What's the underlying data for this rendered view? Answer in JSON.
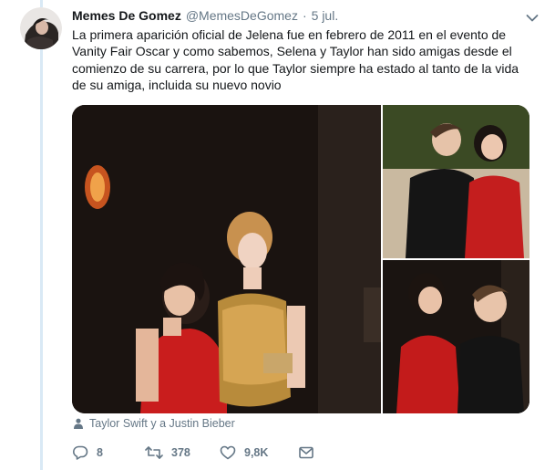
{
  "tweet": {
    "author_name": "Memes De Gomez",
    "handle": "@MemesDeGomez",
    "separator": "·",
    "time": "5 jul.",
    "text": "La primera aparición oficial de Jelena fue en febrero de 2011 en el evento de Vanity Fair Oscar y como sabemos, Selena y Taylor han sido amigas desde el comienzo de su carrera, por lo que Taylor siempre ha estado al tanto de la vida de su amiga, incluida su nuevo novio"
  },
  "media": {
    "tagged_people": "Taylor Swift y a Justin Bieber"
  },
  "actions": {
    "reply_count": "8",
    "retweet_count": "378",
    "like_count": "9,8K"
  },
  "colors": {
    "text": "#14171a",
    "secondary": "#657786",
    "thread_line": "#d9e9f5"
  },
  "icons": [
    "chevron-down-icon",
    "person-icon",
    "reply-icon",
    "retweet-icon",
    "heart-icon",
    "message-icon"
  ]
}
